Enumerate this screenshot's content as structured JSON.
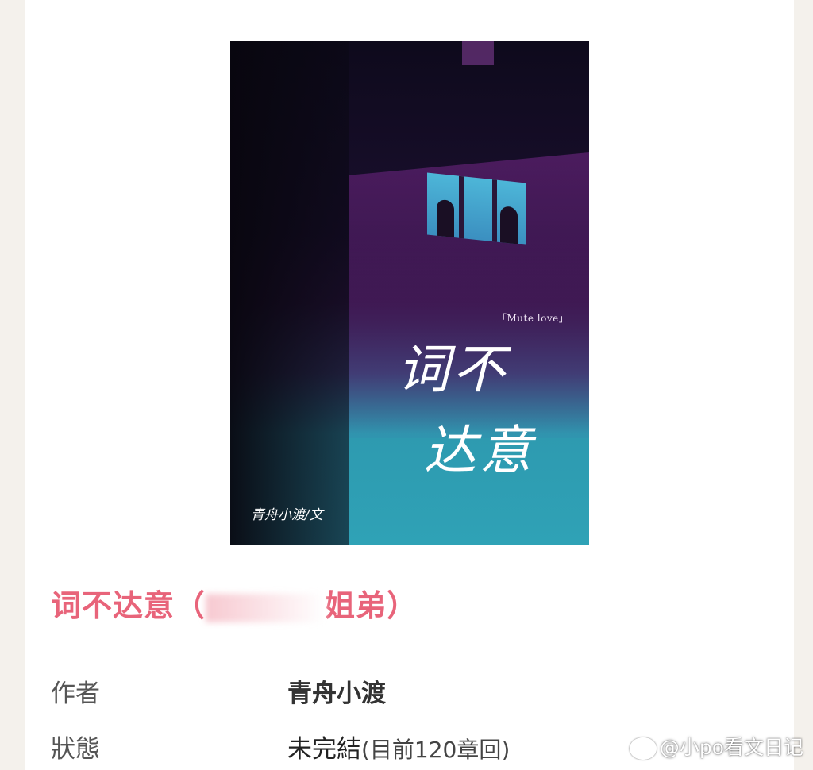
{
  "cover": {
    "subtitle": "「Mute love」",
    "title_line1": "词不",
    "title_line2": "达意",
    "author_signature": "青舟小渡/文"
  },
  "book": {
    "title_prefix": "词不达意（",
    "title_suffix": "姐弟）",
    "title_color": "#e8647a"
  },
  "details": {
    "author_label": "作者",
    "author_value": "青舟小渡",
    "status_label": "狀態",
    "status_value": "未完結",
    "status_note": "(目前120章回)"
  },
  "watermark": {
    "icon": "weibo-icon",
    "text": "@小po看文日记"
  }
}
